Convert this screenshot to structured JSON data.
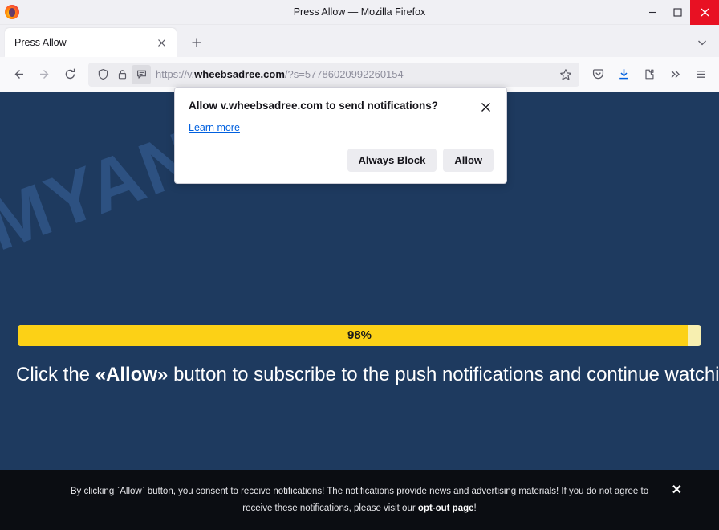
{
  "window": {
    "title": "Press Allow — Mozilla Firefox",
    "logo_icon": "firefox-logo",
    "minimize_label": "Minimize",
    "maximize_label": "Maximize",
    "close_label": "Close"
  },
  "tabs": {
    "items": [
      {
        "title": "Press Allow",
        "close_label": "Close tab"
      }
    ],
    "new_tab_label": "New tab",
    "list_all_label": "List all tabs"
  },
  "navbar": {
    "back_label": "Back",
    "forward_label": "Forward",
    "reload_label": "Reload",
    "url_scheme": "https://v.",
    "url_host": "wheebsadree.com",
    "url_path": "/?s=57786020992260154",
    "url_full": "https://v.wheebsadree.com/?s=57786020992260154",
    "shield_icon": "shield-icon",
    "lock_icon": "padlock-icon",
    "notification_icon": "speech-bubble-icon",
    "bookmark_icon": "star-icon",
    "pocket_icon": "pocket-icon",
    "downloads_icon": "download-icon",
    "extension_icon": "extension-icon",
    "overflow_icon": "chevron-double-right-icon",
    "menu_icon": "hamburger-menu-icon"
  },
  "permission_popup": {
    "title": "Allow v.wheebsadree.com to send notifications?",
    "close_icon": "close-icon",
    "learn_more": "Learn more",
    "always_block": "Always Block",
    "always_block_prefix": "Always ",
    "always_block_accel": "B",
    "always_block_suffix": "lock",
    "allow": "Allow",
    "allow_accel": "A",
    "allow_suffix": "llow"
  },
  "page": {
    "background_color": "#1e3a5f",
    "watermark": "MYANTISPYWARE.COM",
    "progress": {
      "percent": 98,
      "label": "98%",
      "fill_color": "#fcd116",
      "track_color": "#f7efb0"
    },
    "cta_before": "Click the ",
    "cta_bold": "«Allow»",
    "cta_after": " button to subscribe to the push notifications and continue watching"
  },
  "consent_banner": {
    "line1": "By clicking `Allow` button, you consent to receive notifications! The notifications provide news and advertising materials! If you do not agree to",
    "line2_before": "receive these notifications, please visit our ",
    "line2_link": "opt-out page",
    "line2_after": "!",
    "close_label": "✕",
    "background_color": "#0b0d12"
  }
}
